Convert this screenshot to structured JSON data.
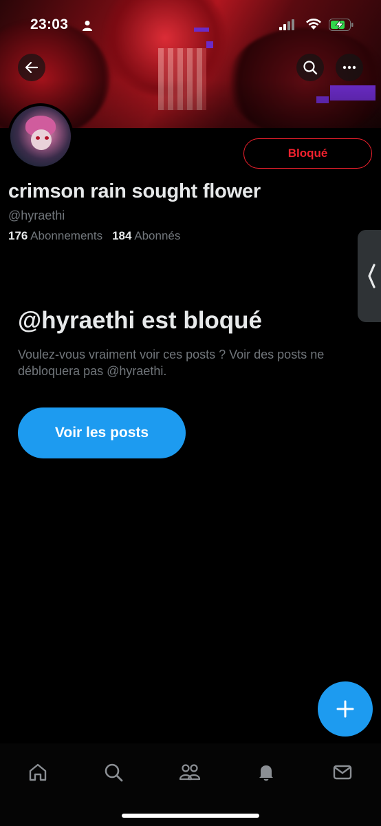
{
  "status_bar": {
    "time": "23:03"
  },
  "profile": {
    "display_name": "crimson rain sought flower",
    "handle": "@hyraethi",
    "following_count": "176",
    "following_label": "Abonnements",
    "followers_count": "184",
    "followers_label": "Abonnés",
    "blocked_button_label": "Bloqué"
  },
  "blocked_notice": {
    "title": "@hyraethi est bloqué",
    "description": "Voulez-vous vraiment voir ces posts ? Voir des posts ne débloquera pas @hyraethi.",
    "view_posts_label": "Voir les posts"
  },
  "bottom_nav": {
    "items": [
      "home-icon",
      "search-icon",
      "communities-icon",
      "notifications-icon",
      "messages-icon"
    ]
  },
  "colors": {
    "accent": "#1d9bf0",
    "danger": "#f4212e",
    "muted_text": "#71767b",
    "primary_text": "#e7e9ea",
    "background": "#000000"
  }
}
